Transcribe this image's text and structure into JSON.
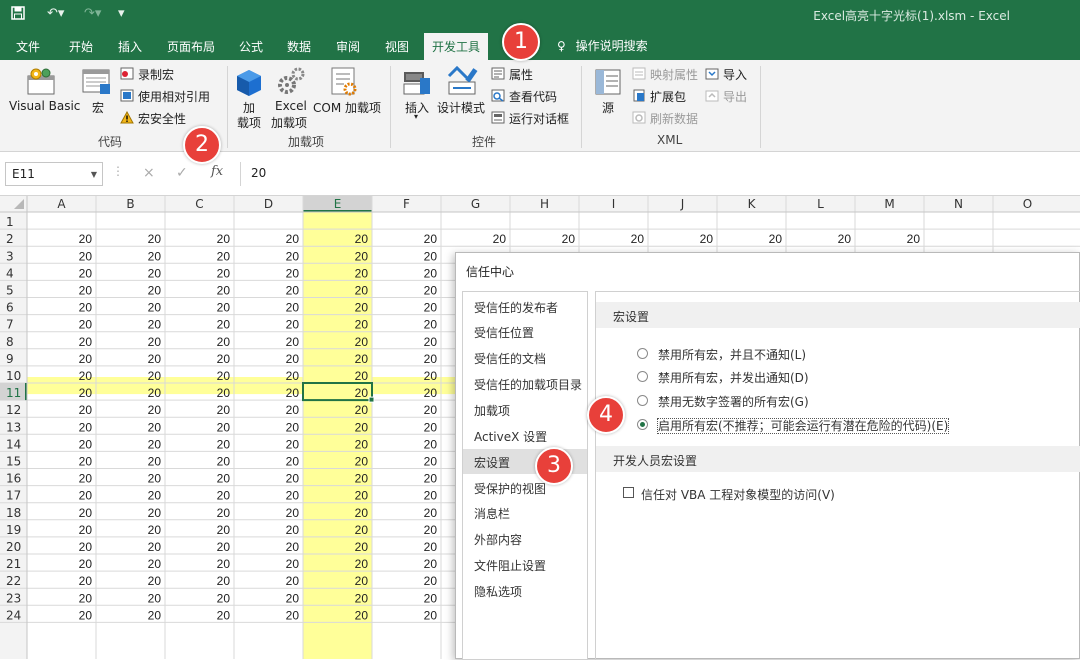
{
  "titlebar": {
    "title": "Excel高亮十字光标(1).xlsm - Excel"
  },
  "tabs": [
    "文件",
    "开始",
    "插入",
    "页面布局",
    "公式",
    "数据",
    "审阅",
    "视图",
    "开发工具"
  ],
  "active_tab": "开发工具",
  "search_tab": "操作说明搜索",
  "ribbon": {
    "code": {
      "visual_basic": "Visual Basic",
      "macro": "宏",
      "record_macro": "录制宏",
      "relative_ref": "使用相对引用",
      "macro_security": "宏安全性",
      "group": "代码"
    },
    "addins": {
      "addin_1": "加",
      "addin_2": "载项",
      "excel_addin_1": "Excel",
      "excel_addin_2": "加载项",
      "com_addin": "COM 加载项",
      "group": "加载项"
    },
    "controls": {
      "insert": "插入",
      "design_mode": "设计模式",
      "properties": "属性",
      "view_code": "查看代码",
      "run_dialog": "运行对话框",
      "group": "控件"
    },
    "xml": {
      "source": "源",
      "map_props": "映射属性",
      "expansion_pack": "扩展包",
      "refresh_data": "刷新数据",
      "import": "导入",
      "export": "导出",
      "group": "XML"
    }
  },
  "formula_bar": {
    "name_box": "E11",
    "cancel": "×",
    "enter": "✓",
    "fx": "fx",
    "value": "20"
  },
  "sheet": {
    "columns": [
      "A",
      "B",
      "C",
      "D",
      "E",
      "F",
      "G",
      "H",
      "I",
      "J",
      "K",
      "L",
      "M",
      "N",
      "O"
    ],
    "rows": [
      "1",
      "2",
      "3",
      "4",
      "5",
      "6",
      "7",
      "8",
      "9",
      "10",
      "11",
      "12",
      "13",
      "14",
      "15",
      "16",
      "17",
      "18",
      "19",
      "20",
      "21",
      "22",
      "23",
      "24"
    ],
    "cell_value": "20",
    "active_cell": "E11",
    "highlight_color": "#ffff99"
  },
  "dialog": {
    "title": "信任中心",
    "nav": [
      "受信任的发布者",
      "受信任位置",
      "受信任的文档",
      "受信任的加载项目录",
      "加载项",
      "ActiveX 设置",
      "宏设置",
      "受保护的视图",
      "消息栏",
      "外部内容",
      "文件阻止设置",
      "隐私选项"
    ],
    "nav_selected": "宏设置",
    "section_macro": "宏设置",
    "options": [
      {
        "label": "禁用所有宏，并且不通知(L)",
        "selected": false
      },
      {
        "label": "禁用所有宏，并发出通知(D)",
        "selected": false
      },
      {
        "label": "禁用无数字签署的所有宏(G)",
        "selected": false
      },
      {
        "label": "启用所有宏(不推荐；可能会运行有潜在危险的代码)(E)",
        "selected": true
      }
    ],
    "section_dev": "开发人员宏设置",
    "vba_trust": "信任对 VBA 工程对象模型的访问(V)"
  },
  "markers": [
    "1",
    "2",
    "3",
    "4"
  ],
  "colors": {
    "accent": "#217346",
    "badge": "#e8403a"
  }
}
